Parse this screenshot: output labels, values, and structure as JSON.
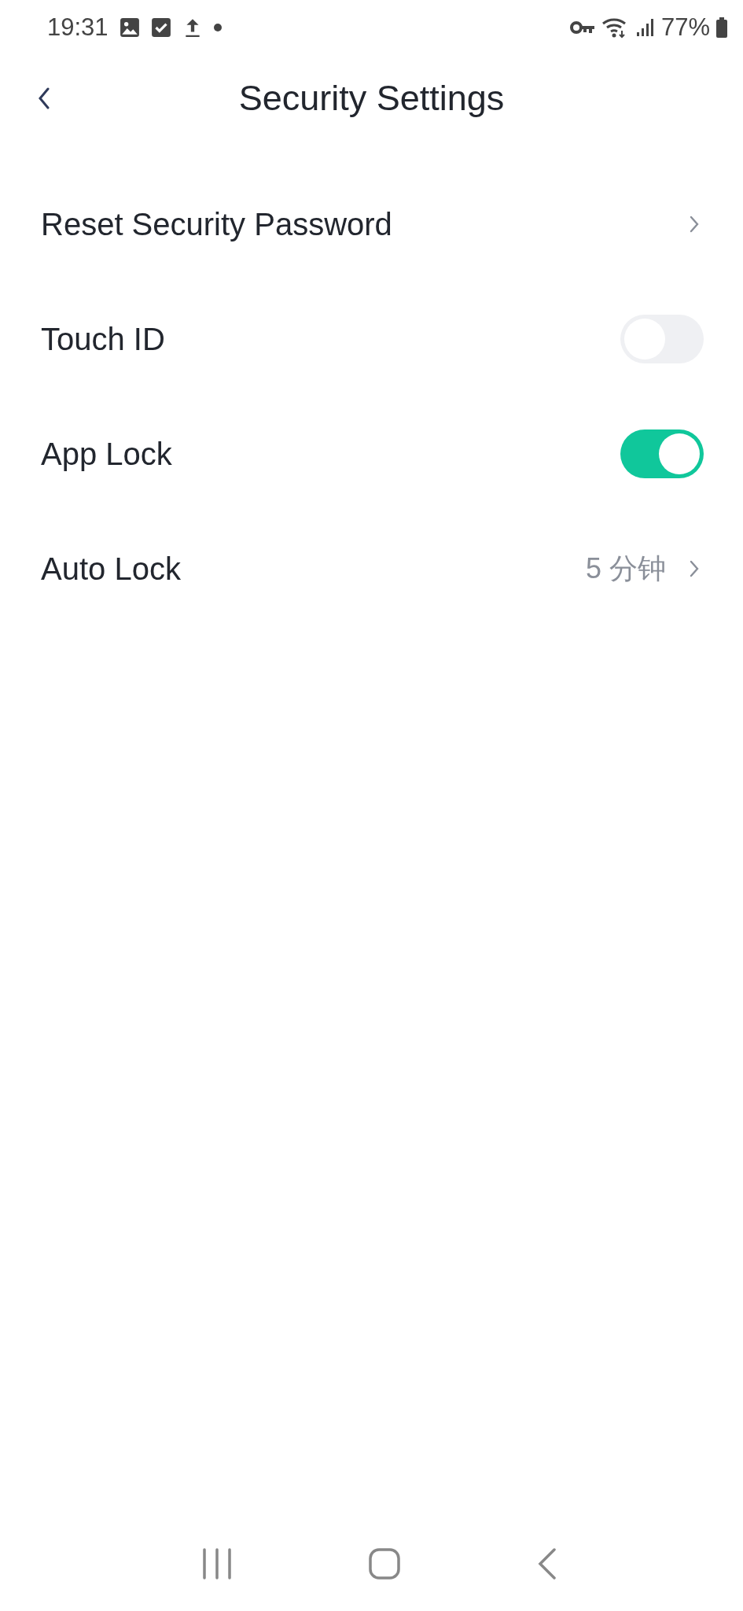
{
  "status_bar": {
    "time": "19:31",
    "battery": "77%"
  },
  "header": {
    "title": "Security Settings"
  },
  "settings": [
    {
      "kind": "link",
      "label": "Reset Security Password"
    },
    {
      "kind": "toggle",
      "label": "Touch ID",
      "on": false
    },
    {
      "kind": "toggle",
      "label": "App Lock",
      "on": true
    },
    {
      "kind": "link",
      "label": "Auto Lock",
      "value": "5 分钟"
    }
  ]
}
